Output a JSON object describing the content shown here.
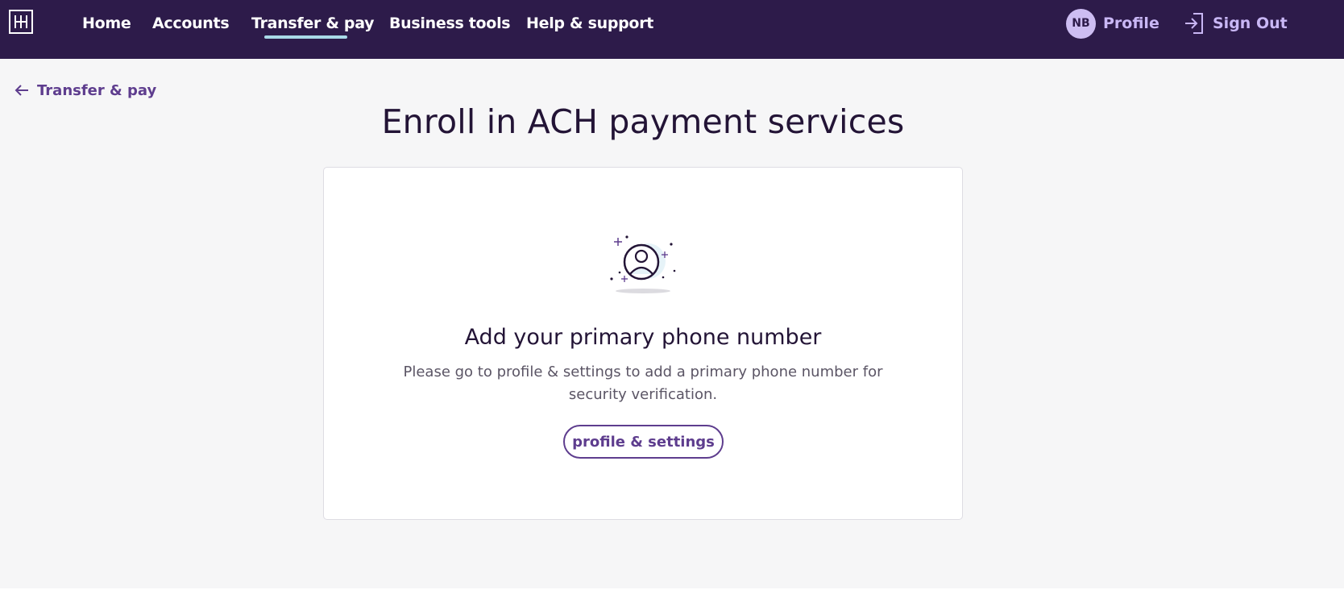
{
  "header": {
    "logo_icon": "bank-logo-icon",
    "nav": [
      {
        "label": "Home"
      },
      {
        "label": "Accounts"
      },
      {
        "label": "Transfer & pay",
        "active": true
      },
      {
        "label": "Business tools"
      },
      {
        "label": "Help & support"
      }
    ],
    "avatar_initials": "NB",
    "profile_label": "Profile",
    "signout_icon": "sign-out-icon",
    "signout_label": "Sign Out"
  },
  "back": {
    "icon": "arrow-left-icon",
    "label": "Transfer & pay"
  },
  "page": {
    "title": "Enroll in ACH payment services"
  },
  "card": {
    "illustration_icon": "user-profile-icon",
    "title": "Add your primary phone number",
    "description": "Please go to profile & settings to add a primary phone number for security verification.",
    "button_label": "profile & settings"
  },
  "colors": {
    "header_bg": "#2d1b4a",
    "accent": "#5e3d8e",
    "nav_underline": "#a9d9e8",
    "page_bg": "#f6f6f7"
  }
}
